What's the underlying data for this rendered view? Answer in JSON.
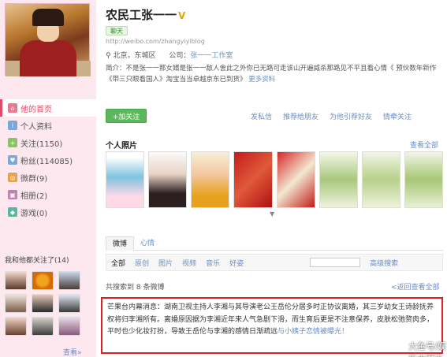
{
  "sidebar": {
    "items": [
      {
        "label": "他的首页",
        "icon": "home-icon"
      },
      {
        "label": "个人资料",
        "icon": "profile-icon"
      },
      {
        "label": "关注(1150)",
        "icon": "follow-icon"
      },
      {
        "label": "粉丝(114085)",
        "icon": "fans-icon"
      },
      {
        "label": "微群(9)",
        "icon": "group-icon"
      },
      {
        "label": "相册(2)",
        "icon": "album-icon"
      },
      {
        "label": "游戏(0)",
        "icon": "game-icon"
      }
    ],
    "follow_title": "我和他都关注了(14)",
    "view_all": "查看»"
  },
  "profile": {
    "name": "农民工张一一",
    "badge": "V",
    "chat": "聊天",
    "url": "http://weibo.com/zhangyiyiblog",
    "location": "北京，东城区",
    "company_label": "公司：",
    "company": "张一一工作室",
    "bio": "简介：不是张一一那女婿是张一一敌人舍此之外你已无路可走该山开遍威杀那路见不平且看心情《 预伙数年新作《带三只眼看国人》淘宝当当卓越京东已到货》",
    "more": "更多资料"
  },
  "actions": {
    "add_follow": "+加关注",
    "links": [
      "发私信",
      "推荐给朋友",
      "为他引荐好友",
      "情牵关注"
    ]
  },
  "photos": {
    "title": "个人照片",
    "view_all": "查看全部",
    "caret": "▼"
  },
  "tabs": [
    "微博",
    "心情"
  ],
  "filters": [
    "全部",
    "原创",
    "图片",
    "视频",
    "音乐",
    "好姿"
  ],
  "advanced_search": "高级搜索",
  "result_count": "共搜索到 8 条微博",
  "back": "<返回查看全部",
  "post": {
    "text": "芒果台内幕消息：湖南卫视主持人李湘与其导演老公王岳伦分居多时正协议离婚，其三岁幼女王诗龄抚养权将归李湘所有。离婚原因据为李湘近年来人气急剧下滑，而生育后更是不注意保养，皮肤松弛赘肉多，平时也少化妆打扮，导致王岳伦与李湘的感情日渐疏远",
    "end": "与小姨子恋情被曝光！"
  },
  "watermark": "大鱼号/娱乐大魔王",
  "colors": {
    "accent": "#e24a6a",
    "link": "#6b8dc2",
    "follow_button": "#5cb85c",
    "highlight_border": "#e02020"
  }
}
